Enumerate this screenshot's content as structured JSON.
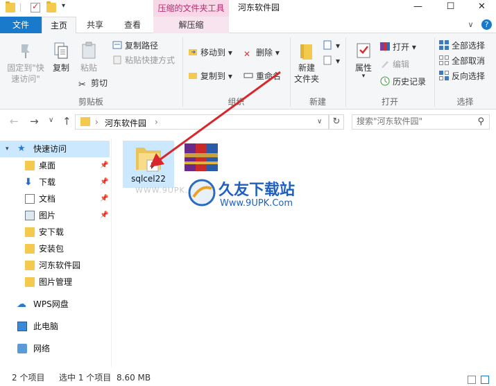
{
  "title_bar": {
    "context_tab_title": "压缩的文件夹工具",
    "window_title": "河东软件园",
    "minimize": "—",
    "maximize": "☐",
    "close": "✕"
  },
  "tabs": {
    "file": "文件",
    "home": "主页",
    "share": "共享",
    "view": "查看",
    "extract": "解压缩",
    "expand": "∨",
    "help": "?"
  },
  "ribbon": {
    "clipboard": {
      "pin_quick": "固定到\"快\n速访问\"",
      "copy": "复制",
      "paste": "粘贴",
      "copy_path": "复制路径",
      "paste_shortcut": "粘贴快捷方式",
      "cut": "剪切",
      "label": "剪贴板"
    },
    "organize": {
      "move_to": "移动到",
      "copy_to": "复制到",
      "delete": "删除",
      "rename": "重命名",
      "label": "组织"
    },
    "new": {
      "new_folder": "新建\n文件夹",
      "label": "新建"
    },
    "open": {
      "properties": "属性",
      "open": "打开",
      "edit": "编辑",
      "history": "历史记录",
      "label": "打开"
    },
    "select": {
      "select_all": "全部选择",
      "select_none": "全部取消",
      "invert": "反向选择",
      "label": "选择"
    }
  },
  "navbar": {
    "back": "←",
    "forward": "→",
    "recent": "∨",
    "up": "↑",
    "crumb_sep": "›",
    "crumb": "河东软件园",
    "dropdown": "∨",
    "refresh": "↻",
    "search_placeholder": "搜索\"河东软件园\"",
    "search_icon": "⚲"
  },
  "nav_pane": {
    "quick_access": "快速访问",
    "items": [
      {
        "label": "桌面",
        "pinned": true
      },
      {
        "label": "下载",
        "pinned": true
      },
      {
        "label": "文档",
        "pinned": true
      },
      {
        "label": "图片",
        "pinned": true
      },
      {
        "label": "安下载",
        "pinned": false
      },
      {
        "label": "安装包",
        "pinned": false
      },
      {
        "label": "河东软件园",
        "pinned": false
      },
      {
        "label": "图片管理",
        "pinned": false
      }
    ],
    "wps": "WPS网盘",
    "this_pc": "此电脑",
    "network": "网络"
  },
  "files": [
    {
      "name": "sqlcel22",
      "type": "folder"
    },
    {
      "name": "",
      "type": "winrar-archive"
    }
  ],
  "watermark": {
    "brand": "久友下载站",
    "url": "Www.9UPK.Com",
    "faint": "WWW.9UPK.COM"
  },
  "status": {
    "count": "2 个项目",
    "selected": "选中 1 个项目",
    "size": "8.60 MB"
  },
  "colors": {
    "accent": "#1979ca",
    "context_tab": "#f8d7e7",
    "selection": "#cce8ff",
    "arrow": "#d9262c"
  }
}
